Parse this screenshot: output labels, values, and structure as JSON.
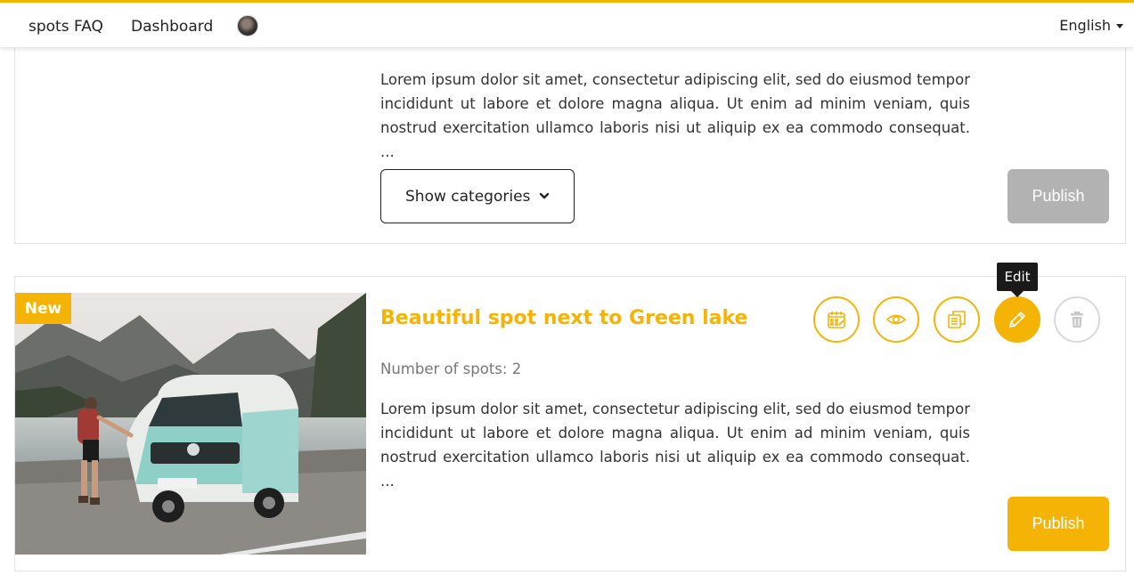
{
  "nav": {
    "faq_label": "spots FAQ",
    "dashboard_label": "Dashboard",
    "language": "English"
  },
  "colors": {
    "accent": "#f5b306",
    "disabled": "#b2b2b2"
  },
  "cards": [
    {
      "description": "Lorem ipsum dolor sit amet, consectetur adipiscing elit, sed do eiusmod tempor incididunt ut labore et dolore magna aliqua. Ut enim ad minim veniam, quis nostrud exercitation ullamco laboris nisi ut aliquip ex ea commodo consequat. ...",
      "categories_button": "Show categories",
      "publish_label": "Publish"
    },
    {
      "badge": "New",
      "title": "Beautiful spot next to Green lake",
      "spot_count": "Number of spots: 2",
      "description": "Lorem ipsum dolor sit amet, consectetur adipiscing elit, sed do eiusmod tempor incididunt ut labore et dolore magna aliqua. Ut enim ad minim veniam, quis nostrud exercitation ullamco laboris nisi ut aliquip ex ea commodo consequat. ...",
      "publish_label": "Publish",
      "tooltip": "Edit",
      "actions": [
        "calendar-icon",
        "eye-icon",
        "copy-icon",
        "pencil-icon",
        "trash-icon"
      ]
    }
  ]
}
